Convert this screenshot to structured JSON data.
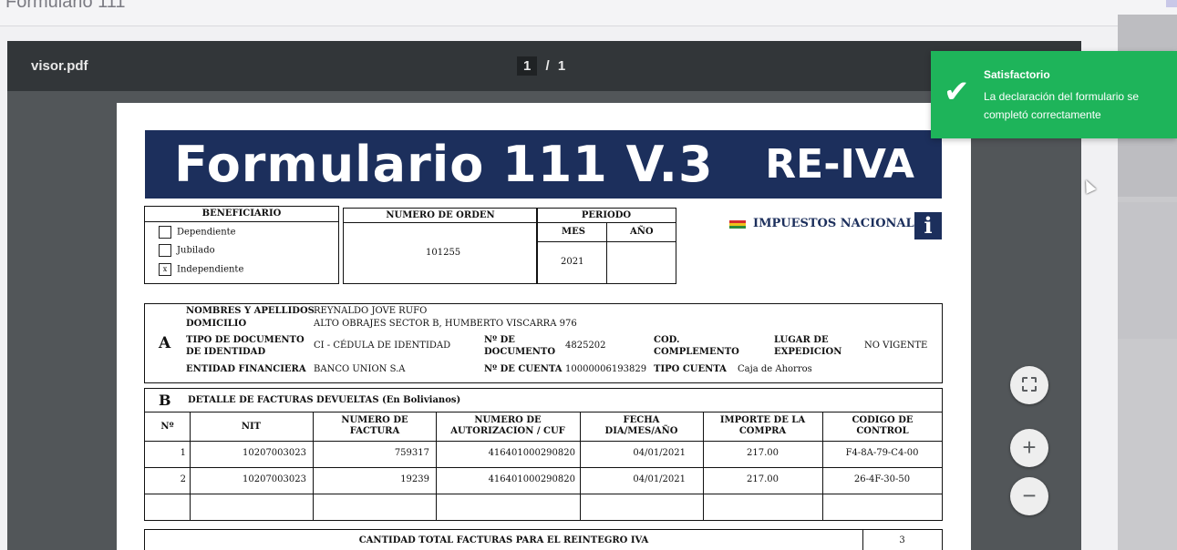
{
  "app": {
    "title": "Formulario 111"
  },
  "viewer": {
    "filename": "visor.pdf",
    "page_current": "1",
    "page_sep": "/",
    "page_total": "1"
  },
  "form": {
    "title": "Formulario 111 V.3",
    "subtitle": "RE-IVA",
    "brand": "IMPUESTOS NACIONALES",
    "beneficiario": {
      "header": "BENEFICIARIO",
      "options": [
        {
          "label": "Dependiente",
          "mark": ""
        },
        {
          "label": "Jubilado",
          "mark": ""
        },
        {
          "label": "Independiente",
          "mark": "x"
        }
      ]
    },
    "orden": {
      "header": "NUMERO DE ORDEN",
      "value": "101255"
    },
    "periodo": {
      "header": "PERIODO",
      "mes_label": "MES",
      "anio_label": "AÑO",
      "mes_value": "2021",
      "anio_value": ""
    },
    "section_a": {
      "letter": "A",
      "nombres_label": "NOMBRES Y APELLIDOS",
      "nombres_value": "REYNALDO JOVE RUFO",
      "domicilio_label": "DOMICILIO",
      "domicilio_value": "ALTO OBRAJES SECTOR B, HUMBERTO VISCARRA 976",
      "tipo_doc_label": "TIPO DE DOCUMENTO DE IDENTIDAD",
      "tipo_doc_value": "CI - CÉDULA DE IDENTIDAD",
      "nro_doc_label": "Nº DE DOCUMENTO",
      "nro_doc_value": "4825202",
      "cod_comp_label": "COD. COMPLEMENTO",
      "cod_comp_value": "",
      "lugar_label": "LUGAR DE EXPEDICION",
      "lugar_value": "NO VIGENTE",
      "entidad_label": "ENTIDAD FINANCIERA",
      "entidad_value": "BANCO UNION S.A",
      "cuenta_label": "Nº DE CUENTA",
      "cuenta_value": "10000006193829",
      "tipo_cuenta_label": "TIPO CUENTA",
      "tipo_cuenta_value": "Caja de Ahorros"
    },
    "section_b": {
      "letter": "B",
      "title": "DETALLE DE FACTURAS DEVUELTAS (En Bolivianos)",
      "columns": [
        "Nº",
        "NIT",
        "NUMERO DE FACTURA",
        "NUMERO DE AUTORIZACION / CUF",
        "FECHA DIA/MES/AÑO",
        "IMPORTE DE LA COMPRA",
        "CODIGO DE CONTROL"
      ],
      "rows": [
        [
          "1",
          "10207003023",
          "759317",
          "416401000290820",
          "04/01/2021",
          "217.00",
          "F4-8A-79-C4-00"
        ],
        [
          "2",
          "10207003023",
          "19239",
          "416401000290820",
          "04/01/2021",
          "217.00",
          "26-4F-30-50"
        ]
      ],
      "total_label": "CANTIDAD TOTAL FACTURAS PARA EL REINTEGRO IVA",
      "total_value": "3"
    }
  },
  "toast": {
    "title": "Satisfactorio",
    "message": "La declaración del formulario se completó correctamente",
    "color": "#1eb45a"
  },
  "controls": {
    "fit_icon": "fit-page-icon",
    "zoom_in": "+",
    "zoom_out": "−"
  }
}
